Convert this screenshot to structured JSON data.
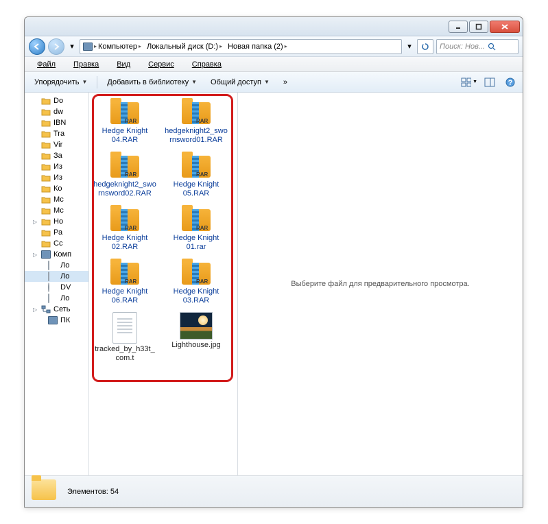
{
  "titlebar": {
    "min": "minimize",
    "max": "maximize",
    "close": "close"
  },
  "breadcrumb": {
    "computer": "Компьютер",
    "disk": "Локальный диск (D:)",
    "folder": "Новая папка (2)"
  },
  "search_placeholder": "Поиск: Нов...",
  "menu": {
    "file": "Файл",
    "edit": "Правка",
    "view": "Вид",
    "tools": "Сервис",
    "help": "Справка"
  },
  "toolbar": {
    "organize": "Упорядочить",
    "library": "Добавить в библиотеку",
    "share": "Общий доступ",
    "more": "»"
  },
  "sidebar": {
    "items": [
      {
        "label": "Do",
        "type": "folder"
      },
      {
        "label": "dw",
        "type": "folder"
      },
      {
        "label": "IBN",
        "type": "folder"
      },
      {
        "label": "Tra",
        "type": "folder"
      },
      {
        "label": "Vir",
        "type": "folder"
      },
      {
        "label": "За",
        "type": "folder"
      },
      {
        "label": "Из",
        "type": "folder"
      },
      {
        "label": "Из",
        "type": "folder"
      },
      {
        "label": "Ко",
        "type": "folder"
      },
      {
        "label": "Мс",
        "type": "folder"
      },
      {
        "label": "Мс",
        "type": "folder"
      },
      {
        "label": "Но",
        "type": "folder",
        "expandable": true
      },
      {
        "label": "Ра",
        "type": "folder"
      },
      {
        "label": "Сс",
        "type": "folder"
      },
      {
        "label": "Комп",
        "type": "computer",
        "expandable": true
      },
      {
        "label": "Ло",
        "type": "drive",
        "level": 2
      },
      {
        "label": "Ло",
        "type": "drive",
        "level": 2,
        "selected": true
      },
      {
        "label": "DV",
        "type": "dvd",
        "level": 2
      },
      {
        "label": "Ло",
        "type": "drive",
        "level": 2
      },
      {
        "label": "Сеть",
        "type": "net",
        "expandable": true
      },
      {
        "label": "ПК",
        "type": "computer",
        "level": 2
      }
    ]
  },
  "files": [
    {
      "name": "Hedge Knight 04.RAR",
      "type": "rar",
      "selected": true
    },
    {
      "name": "hedgeknight2_swornsword01.RAR",
      "type": "rar",
      "selected": true
    },
    {
      "name": "hedgeknight2_swornsword02.RAR",
      "type": "rar",
      "selected": true
    },
    {
      "name": "Hedge Knight 05.RAR",
      "type": "rar",
      "selected": true
    },
    {
      "name": "Hedge Knight 02.RAR",
      "type": "rar",
      "selected": true
    },
    {
      "name": "Hedge Knight 01.rar",
      "type": "rar",
      "selected": true
    },
    {
      "name": "Hedge Knight 06.RAR",
      "type": "rar",
      "selected": true
    },
    {
      "name": "Hedge Knight 03.RAR",
      "type": "rar",
      "selected": true
    },
    {
      "name": "tracked_by_h33t_com.t",
      "type": "txt",
      "selected": false
    },
    {
      "name": "Lighthouse.jpg",
      "type": "img",
      "selected": false
    }
  ],
  "preview_text": "Выберите файл для предварительного просмотра.",
  "status": {
    "label": "Элементов: 54"
  }
}
